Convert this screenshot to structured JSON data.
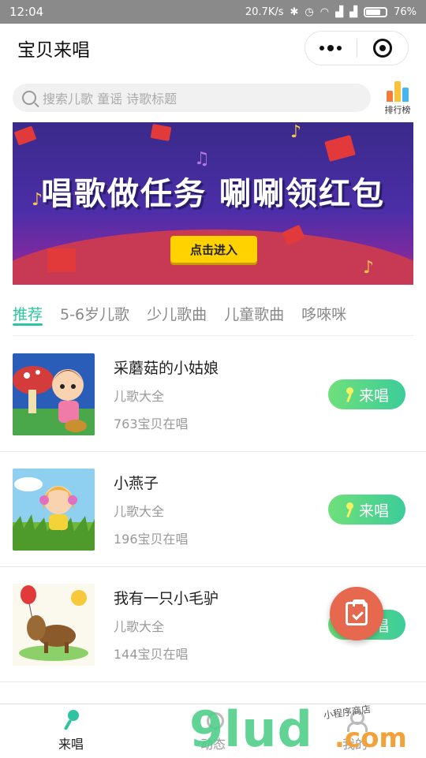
{
  "status_bar": {
    "time": "12:04",
    "speed": "20.7K/s",
    "battery": "76%"
  },
  "header": {
    "title": "宝贝来唱"
  },
  "search": {
    "placeholder": "搜索儿歌 童谣 诗歌标题"
  },
  "ranking": {
    "label": "排行榜"
  },
  "banner": {
    "headline": "唱歌做任务 唰唰领红包",
    "cta_label": "点击进入"
  },
  "tabs": [
    {
      "label": "推荐",
      "active": true
    },
    {
      "label": "5-6岁儿歌"
    },
    {
      "label": "少儿歌曲"
    },
    {
      "label": "儿童歌曲"
    },
    {
      "label": "哆唻咪"
    }
  ],
  "songs": [
    {
      "title": "采蘑菇的小姑娘",
      "category": "儿歌大全",
      "count": "763宝贝在唱",
      "button": "来唱"
    },
    {
      "title": "小燕子",
      "category": "儿歌大全",
      "count": "196宝贝在唱",
      "button": "来唱"
    },
    {
      "title": "我有一只小毛驴",
      "category": "儿歌大全",
      "count": "144宝贝在唱",
      "button": "来唱"
    }
  ],
  "tabbar": [
    {
      "label": "来唱",
      "active": true
    },
    {
      "label": "动态"
    },
    {
      "label": "我的"
    }
  ],
  "watermark": {
    "main": "9lud",
    "suffix": ".com",
    "small": "小程序商店"
  },
  "colors": {
    "accent": "#2ec4a0",
    "button_start": "#6fe07a",
    "button_end": "#3ccc9a",
    "fab": "#e5684f"
  }
}
